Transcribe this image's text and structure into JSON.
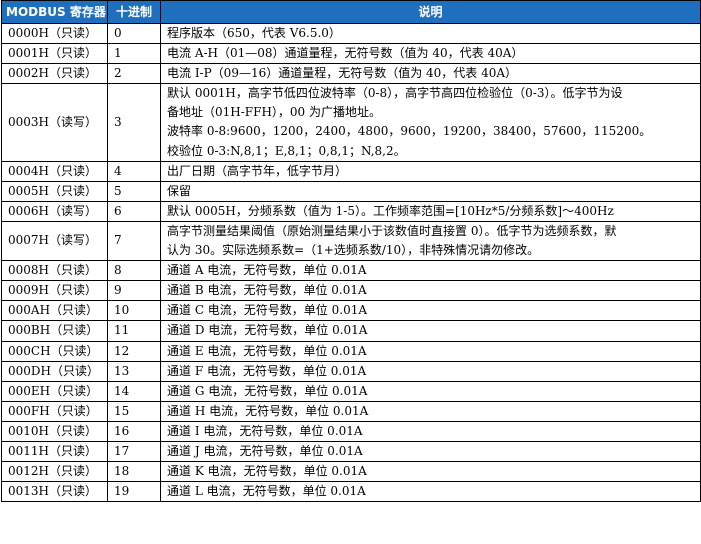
{
  "headers": {
    "register": "MODBUS 寄存器",
    "decimal": "十进制",
    "description": "说明"
  },
  "rows": [
    {
      "register": "0000H（只读）",
      "decimal": "0",
      "lines": [
        "程序版本（650，代表 V6.5.0）"
      ]
    },
    {
      "register": "0001H（只读）",
      "decimal": "1",
      "lines": [
        "电流 A-H（01—08）通道量程，无符号数（值为 40，代表 40A）"
      ]
    },
    {
      "register": "0002H（只读）",
      "decimal": "2",
      "lines": [
        "电流 I-P（09—16）通道量程，无符号数（值为 40，代表 40A）"
      ]
    },
    {
      "register": "0003H（读写）",
      "decimal": "3",
      "lines": [
        "默认 0001H，高字节低四位波特率（0-8），高字节高四位检验位（0-3）。低字节为设",
        "备地址（01H-FFH），00 为广播地址。",
        "波特率 0-8:9600，1200，2400，4800，9600，19200，38400，57600，115200。",
        "校验位 0-3:N,8,1；E,8,1；0,8,1；N,8,2。"
      ]
    },
    {
      "register": "0004H（只读）",
      "decimal": "4",
      "lines": [
        "出厂日期（高字节年，低字节月）"
      ]
    },
    {
      "register": "0005H（只读）",
      "decimal": "5",
      "lines": [
        "保留"
      ]
    },
    {
      "register": "0006H（读写）",
      "decimal": "6",
      "lines": [
        "默认 0005H，分频系数（值为 1-5）。工作频率范围=[10Hz*5/分频系数]～400Hz"
      ]
    },
    {
      "register": "0007H（读写）",
      "decimal": "7",
      "lines": [
        "高字节测量结果阈值（原始测量结果小于该数值时直接置 0）。低字节为选频系数，默",
        "认为 30。实际选频系数=（1+选频系数/10），非特殊情况请勿修改。"
      ]
    },
    {
      "register": "0008H（只读）",
      "decimal": "8",
      "lines": [
        "通道 A 电流，无符号数，单位 0.01A"
      ]
    },
    {
      "register": "0009H（只读）",
      "decimal": "9",
      "lines": [
        "通道 B 电流，无符号数，单位 0.01A"
      ]
    },
    {
      "register": "000AH（只读）",
      "decimal": "10",
      "lines": [
        "通道 C 电流，无符号数，单位 0.01A"
      ]
    },
    {
      "register": "000BH（只读）",
      "decimal": "11",
      "lines": [
        "通道 D 电流，无符号数，单位 0.01A"
      ]
    },
    {
      "register": "000CH（只读）",
      "decimal": "12",
      "lines": [
        "通道 E 电流，无符号数，单位 0.01A"
      ]
    },
    {
      "register": "000DH（只读）",
      "decimal": "13",
      "lines": [
        "通道 F 电流，无符号数，单位 0.01A"
      ]
    },
    {
      "register": "000EH（只读）",
      "decimal": "14",
      "lines": [
        "通道 G 电流，无符号数，单位 0.01A"
      ]
    },
    {
      "register": "000FH（只读）",
      "decimal": "15",
      "lines": [
        "通道 H 电流，无符号数，单位 0.01A"
      ]
    },
    {
      "register": "0010H（只读）",
      "decimal": "16",
      "lines": [
        "通道 I 电流，无符号数，单位 0.01A"
      ]
    },
    {
      "register": "0011H（只读）",
      "decimal": "17",
      "lines": [
        "通道 J 电流，无符号数，单位 0.01A"
      ]
    },
    {
      "register": "0012H（只读）",
      "decimal": "18",
      "lines": [
        "通道 K 电流，无符号数，单位 0.01A"
      ]
    },
    {
      "register": "0013H（只读）",
      "decimal": "19",
      "lines": [
        "通道 L 电流，无符号数，单位 0.01A"
      ]
    }
  ]
}
